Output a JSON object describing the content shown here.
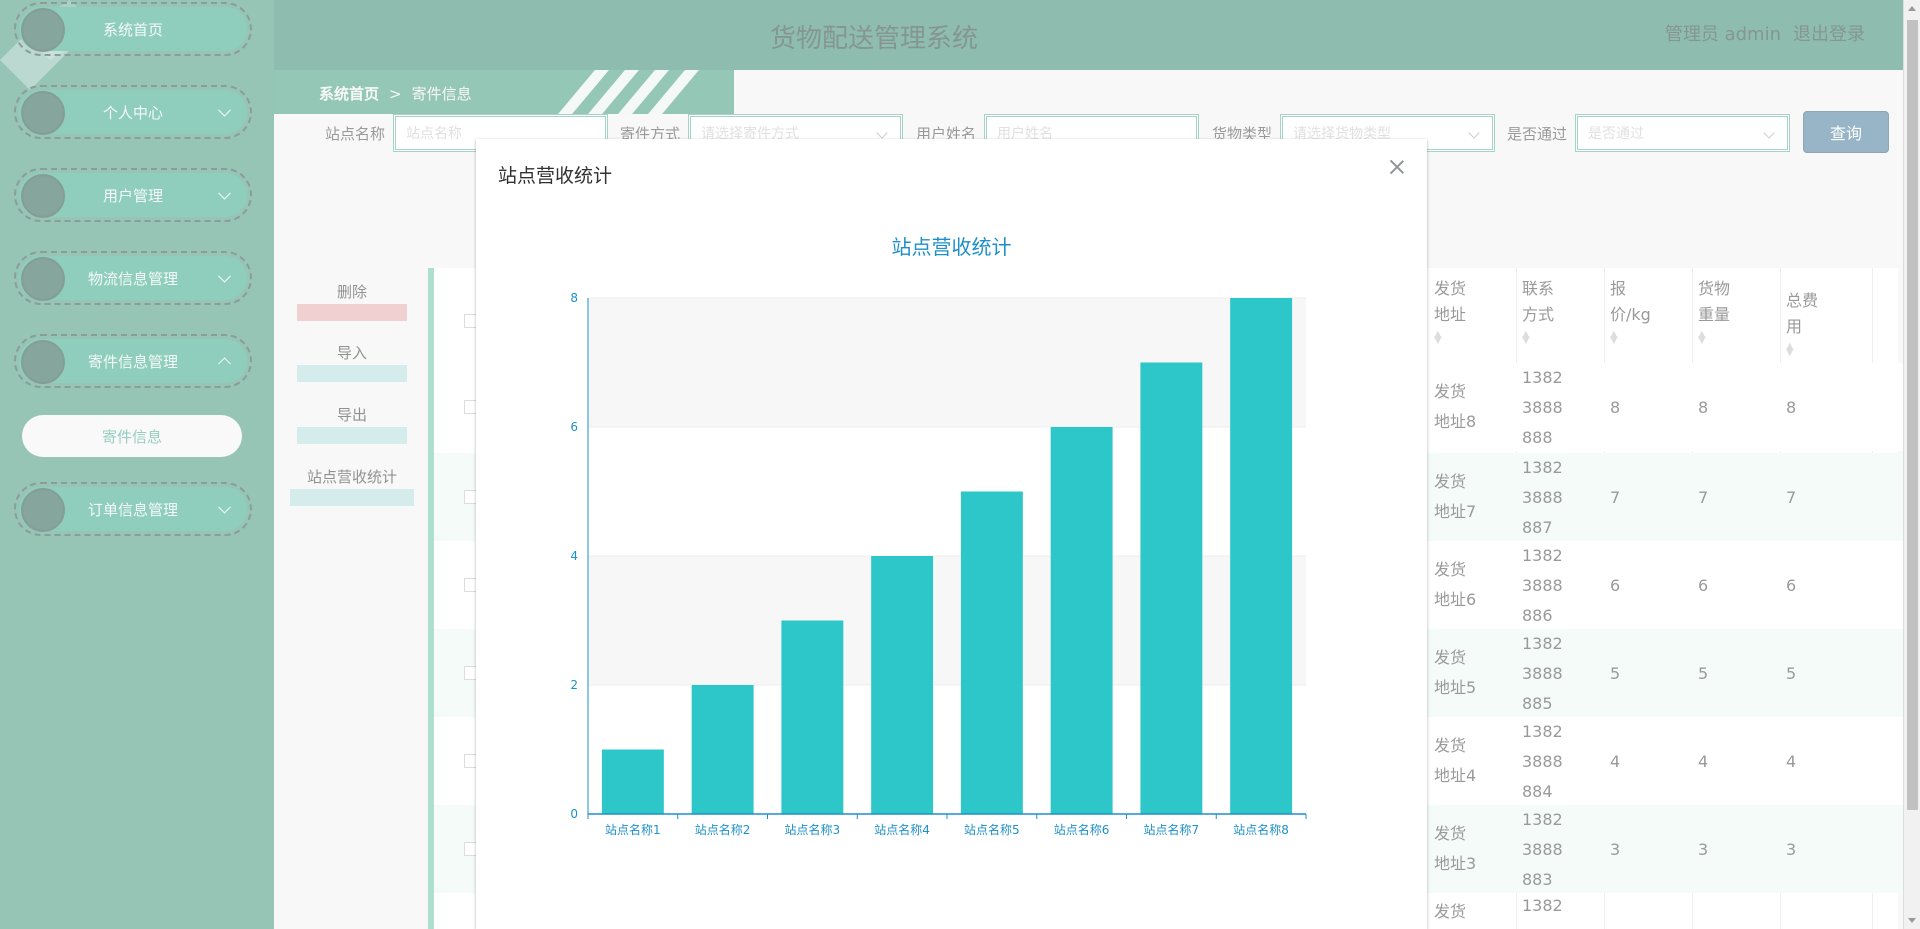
{
  "app": {
    "title": "货物配送管理系统",
    "user": "管理员 admin",
    "logout": "退出登录"
  },
  "sidebar": {
    "items": [
      {
        "label": "系统首页",
        "has_chevron": false
      },
      {
        "label": "个人中心",
        "has_chevron": true
      },
      {
        "label": "用户管理",
        "has_chevron": true
      },
      {
        "label": "物流信息管理",
        "has_chevron": true
      },
      {
        "label": "寄件信息管理",
        "has_chevron": true,
        "expanded": true
      },
      {
        "label": "订单信息管理",
        "has_chevron": true
      }
    ],
    "subitem": "寄件信息"
  },
  "breadcrumb": {
    "home": "系统首页",
    "separator": ">",
    "current": "寄件信息"
  },
  "search": {
    "fields": [
      {
        "label": "站点名称",
        "placeholder": "站点名称"
      },
      {
        "label": "寄件方式",
        "placeholder": "请选择寄件方式"
      },
      {
        "label": "用户姓名",
        "placeholder": "用户姓名"
      },
      {
        "label": "货物类型",
        "placeholder": "请选择货物类型"
      },
      {
        "label": "是否通过",
        "placeholder": "是否通过"
      }
    ],
    "button": "查询"
  },
  "actions": {
    "delete": "删除",
    "import": "导入",
    "export": "导出",
    "stats": "站点营收统计"
  },
  "table": {
    "headers": {
      "address": "发货地址",
      "contact": "联系方式",
      "price": "报价/kg",
      "weight": "货物重量",
      "total": "总费用"
    },
    "rows": [
      {
        "address": "发货地址8",
        "contact": "13823888888",
        "price": "8",
        "weight": "8",
        "total": "8"
      },
      {
        "address": "发货地址7",
        "contact": "13823888887",
        "price": "7",
        "weight": "7",
        "total": "7"
      },
      {
        "address": "发货地址6",
        "contact": "13823888886",
        "price": "6",
        "weight": "6",
        "total": "6"
      },
      {
        "address": "发货地址5",
        "contact": "13823888885",
        "price": "5",
        "weight": "5",
        "total": "5"
      },
      {
        "address": "发货地址4",
        "contact": "13823888884",
        "price": "4",
        "weight": "4",
        "total": "4"
      },
      {
        "address": "发货地址3",
        "contact": "13823888883",
        "price": "3",
        "weight": "3",
        "total": "3"
      }
    ],
    "partial_row": {
      "address": "发货",
      "contact": "1382"
    }
  },
  "modal": {
    "title": "站点营收统计"
  },
  "chart_data": {
    "type": "bar",
    "title": "站点营收统计",
    "categories": [
      "站点名称1",
      "站点名称2",
      "站点名称3",
      "站点名称4",
      "站点名称5",
      "站点名称6",
      "站点名称7",
      "站点名称8"
    ],
    "values": [
      1,
      2,
      3,
      4,
      5,
      6,
      7,
      8
    ],
    "yticks": [
      "0",
      "2",
      "4",
      "6",
      "8"
    ],
    "ylim": [
      0,
      8
    ],
    "xlabel": "",
    "ylabel": "",
    "grid": true,
    "bar_color": "#2ec7c9",
    "axis_color": "#1e90c8"
  },
  "colors": {
    "primary": "#1c7a5e",
    "sidebar": "#2d8a6d",
    "accent": "#2ec7c9"
  }
}
